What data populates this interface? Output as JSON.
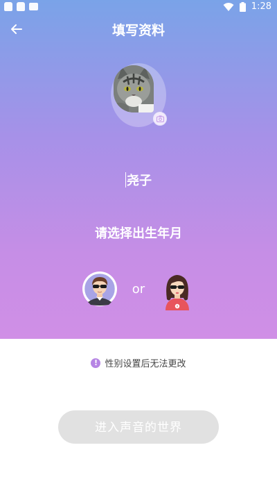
{
  "status_bar": {
    "time": "1:28"
  },
  "header": {
    "title": "填写资料"
  },
  "profile": {
    "nickname": "尧子"
  },
  "birthdate": {
    "label": "请选择出生年月"
  },
  "gender": {
    "or_label": "or"
  },
  "hint": {
    "text": "性别设置后无法更改",
    "icon_text": "!"
  },
  "submit": {
    "label": "进入声音的世界"
  },
  "colors": {
    "gradient_top": "#7aa3e8",
    "gradient_bottom": "#d08fe6",
    "accent": "#b685e4",
    "button_disabled": "#e1e1e1"
  }
}
